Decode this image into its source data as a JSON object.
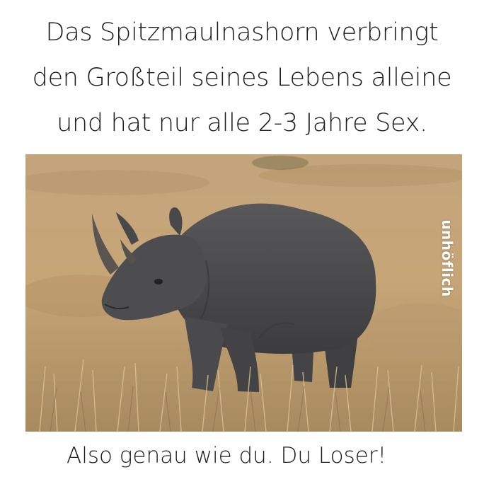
{
  "caption_top": {
    "line1": "Das Spitzmaulnashorn verbringt",
    "line2": "den Großteil seines Lebens alleine",
    "line3": "und hat nur alle 2-3 Jahre Sex."
  },
  "watermark": {
    "vertical_text": "unhöflich"
  },
  "caption_bottom": "Also genau wie du. Du Loser!",
  "colors": {
    "background": "#ffffff",
    "text": "#1c1c1c",
    "grass_light": "#c9a878",
    "grass_dark": "#8d6f48",
    "rhino": "#4a4a4c"
  }
}
